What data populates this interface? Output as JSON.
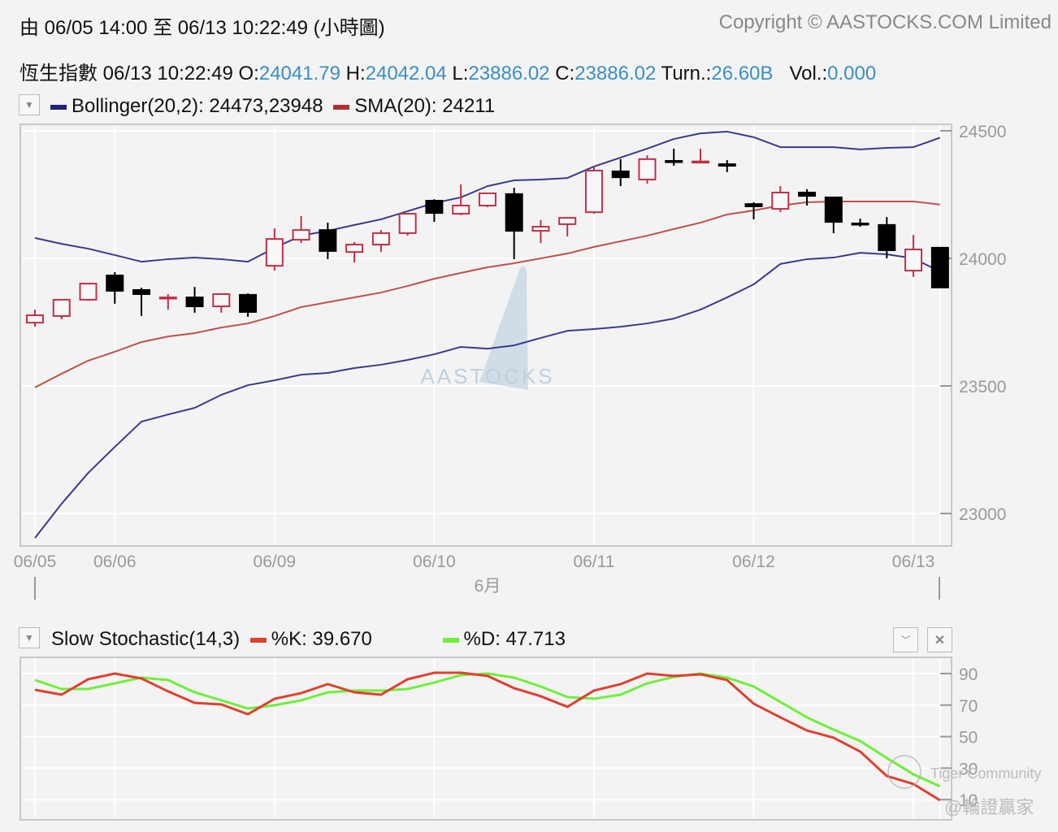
{
  "header": {
    "range_label": "由  06/05 14:00 至  06/13 10:22:49 (小時圖)",
    "copyright": "Copyright © AASTOCKS.COM Limited"
  },
  "quote": {
    "name": "恆生指數",
    "datetime": "06/13 10:22:49",
    "open_label": "O:",
    "open": "24041.79",
    "high_label": "H:",
    "high": "24042.04",
    "low_label": "L:",
    "low": "23886.02",
    "close_label": "C:",
    "close": "23886.02",
    "turnover_label": "Turn.:",
    "turnover": "26.60B",
    "volume_label": "Vol.:",
    "volume": "0.000"
  },
  "main_legend": {
    "bollinger": "Bollinger(20,2): 24473,23948",
    "sma": "SMA(20): 24211",
    "bollinger_color": "#2a2a7a",
    "sma_color": "#b03a3a"
  },
  "stoch_legend": {
    "title": "Slow Stochastic(14,3)",
    "k": "%K: 39.670",
    "d": "%D: 47.713",
    "k_color": "#e04030",
    "d_color": "#6ef03a"
  },
  "watermarks": {
    "aastocks": "AASTOCKS",
    "tiger": "Tiger Community",
    "author": "@輪證贏家"
  },
  "chart_data": [
    {
      "type": "candlestick",
      "title": "恆生指數 hourly",
      "ylim": [
        22850,
        24560
      ],
      "yticks": [
        "24500",
        "24000",
        "23500",
        "23000"
      ],
      "ytick_values": [
        24500,
        24000,
        23500,
        23000
      ],
      "xticks": [
        {
          "i": 0,
          "label": "06/05"
        },
        {
          "i": 3,
          "label": "06/06"
        },
        {
          "i": 9,
          "label": "06/09"
        },
        {
          "i": 15,
          "label": "06/10"
        },
        {
          "i": 21,
          "label": "06/11"
        },
        {
          "i": 27,
          "label": "06/12"
        },
        {
          "i": 33,
          "label": "06/13"
        }
      ],
      "month_label": "6月",
      "ohlc": [
        [
          23748,
          23799,
          23732,
          23777
        ],
        [
          23774,
          23838,
          23761,
          23838
        ],
        [
          23838,
          23901,
          23834,
          23901
        ],
        [
          23933,
          23946,
          23822,
          23873
        ],
        [
          23876,
          23885,
          23774,
          23860
        ],
        [
          23844,
          23860,
          23799,
          23847
        ],
        [
          23847,
          23888,
          23787,
          23812
        ],
        [
          23812,
          23860,
          23787,
          23860
        ],
        [
          23857,
          23863,
          23771,
          23790
        ],
        [
          23971,
          24118,
          23952,
          24076
        ],
        [
          24073,
          24166,
          24060,
          24111
        ],
        [
          24111,
          24140,
          23997,
          24029
        ],
        [
          24025,
          24064,
          23984,
          24054
        ],
        [
          24054,
          24111,
          24025,
          24099
        ],
        [
          24099,
          24175,
          24089,
          24175
        ],
        [
          24226,
          24232,
          24143,
          24178
        ],
        [
          24175,
          24290,
          24169,
          24207
        ],
        [
          24207,
          24258,
          24201,
          24255
        ],
        [
          24252,
          24277,
          23997,
          24108
        ],
        [
          24108,
          24150,
          24060,
          24124
        ],
        [
          24134,
          24159,
          24086,
          24159
        ],
        [
          24181,
          24357,
          24175,
          24344
        ],
        [
          24341,
          24389,
          24283,
          24318
        ],
        [
          24309,
          24404,
          24293,
          24389
        ],
        [
          24382,
          24430,
          24363,
          24379
        ],
        [
          24378,
          24430,
          24376,
          24380
        ],
        [
          24369,
          24385,
          24338,
          24363
        ],
        [
          24213,
          24220,
          24153,
          24204
        ],
        [
          24194,
          24283,
          24181,
          24258
        ],
        [
          24258,
          24271,
          24207,
          24245
        ],
        [
          24239,
          24242,
          24099,
          24143
        ],
        [
          24137,
          24156,
          24124,
          24135
        ],
        [
          24131,
          24162,
          24000,
          24032
        ],
        [
          23952,
          24092,
          23927,
          24035
        ],
        [
          24041.79,
          24042.04,
          23886.02,
          23886.02
        ]
      ],
      "series": [
        {
          "name": "Bollinger Upper",
          "color": "#3a3a8a",
          "values": [
            24080,
            24057,
            24038,
            24013,
            23987,
            23997,
            24003,
            23997,
            23987,
            24041,
            24089,
            24108,
            24131,
            24153,
            24185,
            24217,
            24239,
            24283,
            24306,
            24309,
            24315,
            24360,
            24395,
            24430,
            24468,
            24490,
            24497,
            24475,
            24436,
            24436,
            24436,
            24427,
            24433,
            24436,
            24473
          ]
        },
        {
          "name": "SMA(20)",
          "color": "#c05050",
          "values": [
            23494,
            23548,
            23599,
            23634,
            23672,
            23694,
            23707,
            23729,
            23745,
            23774,
            23809,
            23828,
            23847,
            23866,
            23892,
            23920,
            23943,
            23965,
            23981,
            24000,
            24019,
            24045,
            24067,
            24089,
            24115,
            24140,
            24172,
            24188,
            24207,
            24220,
            24223,
            24223,
            24223,
            24223,
            24211
          ]
        },
        {
          "name": "Bollinger Lower",
          "color": "#3a3a8a",
          "values": [
            22904,
            23038,
            23159,
            23261,
            23360,
            23388,
            23414,
            23465,
            23503,
            23522,
            23544,
            23551,
            23570,
            23583,
            23602,
            23624,
            23653,
            23646,
            23659,
            23688,
            23716,
            23723,
            23732,
            23745,
            23764,
            23799,
            23847,
            23898,
            23978,
            23997,
            24003,
            24022,
            24016,
            24000,
            23948
          ]
        }
      ]
    },
    {
      "type": "line",
      "title": "Slow Stochastic(14,3)",
      "ylim": [
        0,
        100
      ],
      "yticks": [
        "90",
        "70",
        "50",
        "30",
        "10"
      ],
      "ytick_values": [
        90,
        70,
        50,
        30,
        10
      ],
      "series": [
        {
          "name": "%K",
          "color": "#e04030",
          "values": [
            79.7,
            76.6,
            86.4,
            90,
            86.9,
            78.7,
            71.4,
            70.4,
            64.2,
            74,
            77.6,
            83.3,
            78.1,
            76.6,
            86.4,
            90.5,
            90.5,
            88.5,
            80.7,
            75.6,
            68.9,
            79.2,
            83.3,
            90,
            88.5,
            89.5,
            85.9,
            70.9,
            62.2,
            53.9,
            49.3,
            40.5,
            25,
            19.9,
            9.6
          ]
        },
        {
          "name": "%D",
          "color": "#6ef03a",
          "values": [
            85.9,
            80.2,
            80.2,
            83.8,
            87.4,
            85.9,
            78.1,
            73,
            67.8,
            69.9,
            73,
            78.1,
            79.2,
            79.2,
            80.2,
            84.3,
            89,
            90,
            87.4,
            81.8,
            75.1,
            74,
            76.6,
            83.8,
            87.9,
            90,
            87.4,
            81.8,
            72,
            62.2,
            54.4,
            47.2,
            36.4,
            26.1,
            18.4
          ]
        }
      ]
    }
  ]
}
